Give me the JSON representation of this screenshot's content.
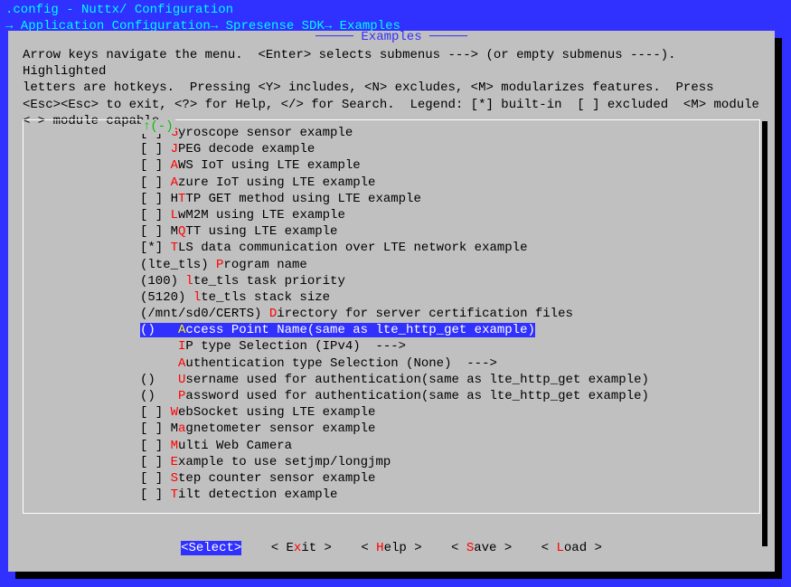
{
  "titlebar": {
    "line1": ".config - Nuttx/ Configuration",
    "line2": "→ Application Configuration→ Spresense SDK→ Examples"
  },
  "panel_title": "Examples",
  "help_text": "Arrow keys navigate the menu.  <Enter> selects submenus ---> (or empty submenus ----).  Highlighted\nletters are hotkeys.  Pressing <Y> includes, <N> excludes, <M> modularizes features.  Press\n<Esc><Esc> to exit, <?> for Help, </> for Search.  Legend: [*] built-in  [ ] excluded  <M> module\n< > module capable",
  "scroll_indicator": "↑(-)",
  "items": [
    {
      "prefix": "[ ] ",
      "hot": "G",
      "rest": "yroscope sensor example"
    },
    {
      "prefix": "[ ] ",
      "hot": "J",
      "rest": "PEG decode example"
    },
    {
      "prefix": "[ ] ",
      "hot": "A",
      "rest": "WS IoT using LTE example"
    },
    {
      "prefix": "[ ] ",
      "hot": "A",
      "rest": "zure IoT using LTE example"
    },
    {
      "prefix": "[ ] H",
      "hot": "T",
      "rest": "TP GET method using LTE example"
    },
    {
      "prefix": "[ ] ",
      "hot": "L",
      "rest": "wM2M using LTE example"
    },
    {
      "prefix": "[ ] M",
      "hot": "Q",
      "rest": "TT using LTE example"
    },
    {
      "prefix": "[*] ",
      "hot": "T",
      "rest": "LS data communication over LTE network example"
    },
    {
      "prefix": "(lte_tls) ",
      "hot": "P",
      "rest": "rogram name"
    },
    {
      "prefix": "(100) ",
      "hot": "l",
      "rest": "te_tls task priority"
    },
    {
      "prefix": "(5120) ",
      "hot": "l",
      "rest": "te_tls stack size"
    },
    {
      "prefix": "(/mnt/sd0/CERTS) ",
      "hot": "D",
      "rest": "irectory for server certification files"
    },
    {
      "prefix": "()   ",
      "hot": "A",
      "rest": "ccess Point Name(same as lte_http_get example)",
      "selected": true
    },
    {
      "prefix": "     ",
      "hot": "I",
      "rest": "P type Selection (IPv4)  --->"
    },
    {
      "prefix": "     ",
      "hot": "A",
      "rest": "uthentication type Selection (None)  --->"
    },
    {
      "prefix": "()   ",
      "hot": "U",
      "rest": "sername used for authentication(same as lte_http_get example)"
    },
    {
      "prefix": "()   ",
      "hot": "P",
      "rest": "assword used for authentication(same as lte_http_get example)"
    },
    {
      "prefix": "[ ] ",
      "hot": "W",
      "rest": "ebSocket using LTE example"
    },
    {
      "prefix": "[ ] M",
      "hot": "a",
      "rest": "gnetometer sensor example"
    },
    {
      "prefix": "[ ] ",
      "hot": "M",
      "rest": "ulti Web Camera"
    },
    {
      "prefix": "[ ] ",
      "hot": "E",
      "rest": "xample to use setjmp/longjmp"
    },
    {
      "prefix": "[ ] ",
      "hot": "S",
      "rest": "tep counter sensor example"
    },
    {
      "prefix": "[ ] ",
      "hot": "T",
      "rest": "ilt detection example"
    }
  ],
  "buttons": {
    "select": "Select",
    "exit_pre": "E",
    "exit_hot": "x",
    "exit_post": "it",
    "help_pre": "",
    "help_hot": "H",
    "help_post": "elp",
    "save_pre": "",
    "save_hot": "S",
    "save_post": "ave",
    "load_pre": "",
    "load_hot": "L",
    "load_post": "oad"
  }
}
